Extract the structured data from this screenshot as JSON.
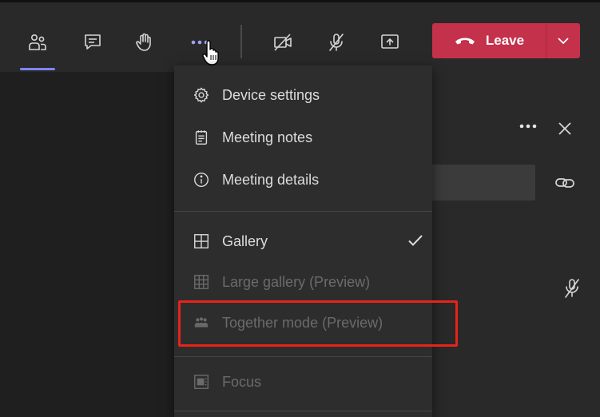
{
  "toolbar": {
    "leave_label": "Leave",
    "icons": [
      "people-icon",
      "chat-icon",
      "raise-hand-icon",
      "more-options-icon",
      "camera-off-icon",
      "mic-off-icon",
      "share-screen-icon"
    ]
  },
  "menu": {
    "items": [
      {
        "label": "Device settings",
        "icon": "gear-icon",
        "enabled": true
      },
      {
        "label": "Meeting notes",
        "icon": "notes-icon",
        "enabled": true
      },
      {
        "label": "Meeting details",
        "icon": "info-icon",
        "enabled": true
      },
      {
        "label": "Gallery",
        "icon": "gallery-icon",
        "enabled": true,
        "checked": true
      },
      {
        "label": "Large gallery (Preview)",
        "icon": "large-gallery-icon",
        "enabled": false
      },
      {
        "label": "Together mode (Preview)",
        "icon": "together-mode-icon",
        "enabled": false
      },
      {
        "label": "Focus",
        "icon": "focus-icon",
        "enabled": false
      }
    ]
  },
  "colors": {
    "accent": "#7f85f5",
    "leave_button": "#c4314b",
    "highlight": "#e8231a"
  }
}
